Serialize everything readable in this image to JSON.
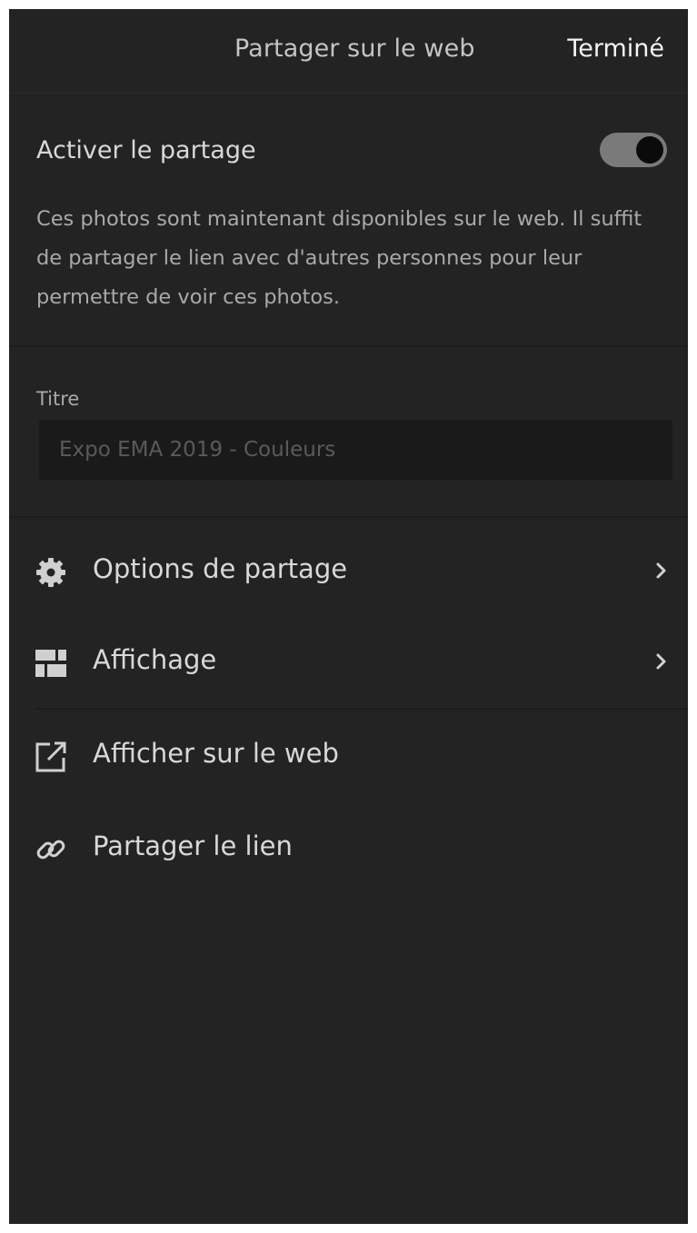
{
  "header": {
    "title": "Partager sur le web",
    "done_label": "Terminé"
  },
  "sharing": {
    "toggle_label": "Activer le partage",
    "enabled": true,
    "description": "Ces photos sont maintenant disponibles sur le web. Il suffit de partager le lien avec d'autres personnes pour leur permettre de voir ces photos."
  },
  "title_field": {
    "label": "Titre",
    "placeholder": "Expo EMA 2019 - Couleurs"
  },
  "menu": [
    {
      "label": "Options de partage",
      "icon": "gear-icon",
      "has_chevron": true
    },
    {
      "label": "Affichage",
      "icon": "layout-grid-icon",
      "has_chevron": true
    },
    {
      "label": "Afficher sur le web",
      "icon": "external-link-icon",
      "has_chevron": false
    },
    {
      "label": "Partager le lien",
      "icon": "link-icon",
      "has_chevron": false
    }
  ],
  "colors": {
    "background": "#232323",
    "text_primary": "#d8d8d8",
    "text_secondary": "#a9a9a9",
    "toggle_track": "#7a7a7a",
    "input_background": "#1a1a1a"
  }
}
